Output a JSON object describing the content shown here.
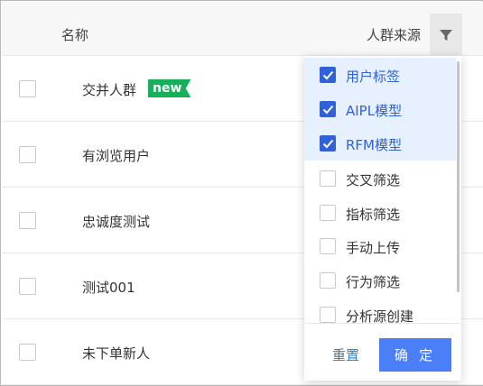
{
  "table": {
    "headers": {
      "name": "名称",
      "source": "人群来源"
    },
    "rows": [
      {
        "name": "交并人群",
        "badge": "new"
      },
      {
        "name": "有浏览用户"
      },
      {
        "name": "忠诚度测试"
      },
      {
        "name": "测试001"
      },
      {
        "name": "未下单新人"
      }
    ]
  },
  "filter_dropdown": {
    "options": [
      {
        "label": "用户标签",
        "checked": true
      },
      {
        "label": "AIPL模型",
        "checked": true
      },
      {
        "label": "RFM模型",
        "checked": true
      },
      {
        "label": "交叉筛选",
        "checked": false
      },
      {
        "label": "指标筛选",
        "checked": false
      },
      {
        "label": "手动上传",
        "checked": false
      },
      {
        "label": "行为筛选",
        "checked": false
      },
      {
        "label": "分析源创建",
        "checked": false
      }
    ],
    "reset_label": "重置",
    "confirm_label": "确 定"
  },
  "colors": {
    "accent": "#2f62d8",
    "confirm": "#4a7ff7",
    "badge": "#16b05a",
    "checked_bg": "#e6f0fe"
  },
  "icons": {
    "filter": "filter-funnel-icon",
    "check": "checkmark-icon"
  }
}
